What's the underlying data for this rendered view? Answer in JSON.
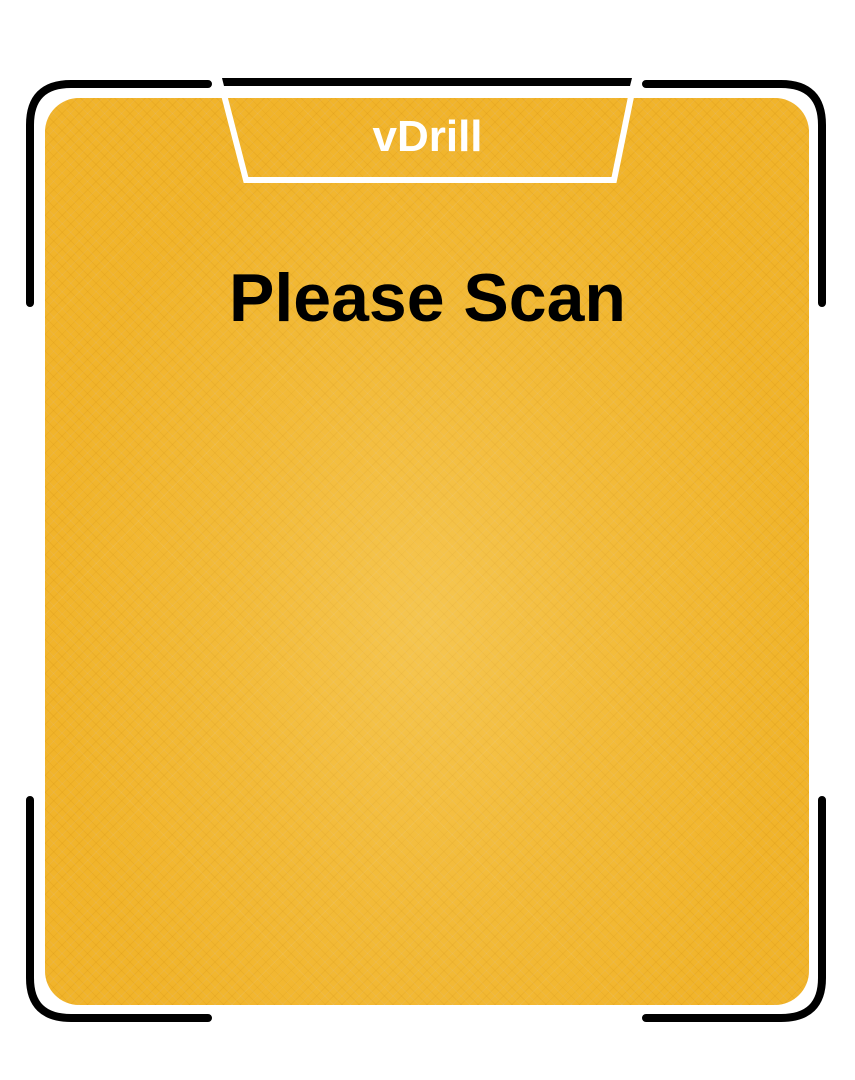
{
  "app": {
    "name": "vDrill"
  },
  "screen": {
    "prompt": "Please Scan"
  },
  "colors": {
    "panel": "#f1b42a",
    "frame": "#000000",
    "tab_outline": "#ffffff",
    "title_text": "#ffffff",
    "prompt_text": "#000000"
  }
}
